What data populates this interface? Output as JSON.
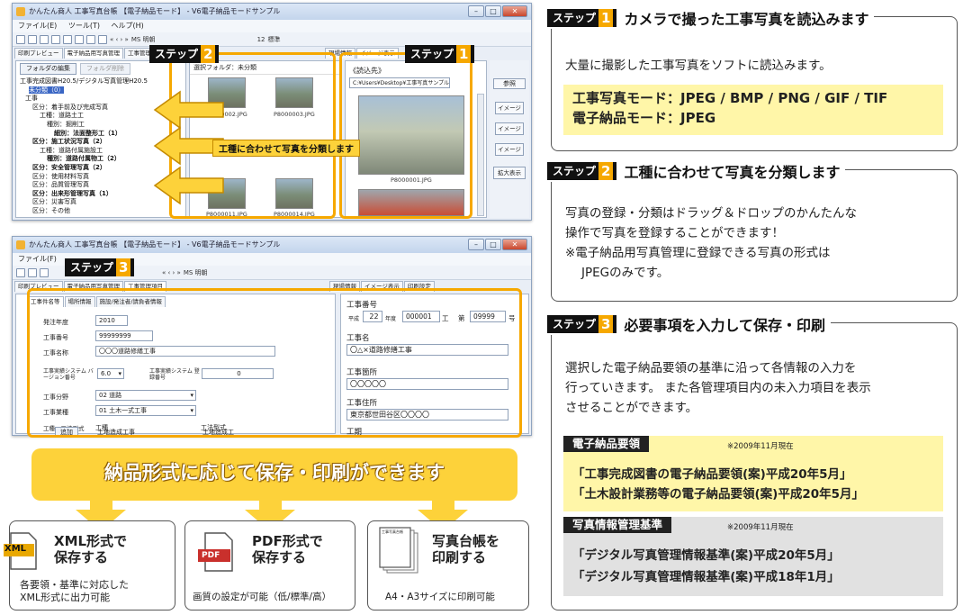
{
  "colors": {
    "accent": "#f6a800",
    "banner": "#fdd23a",
    "badge_bg": "#111111",
    "yellow_box": "#fff6a8",
    "gray_box": "#e1e1e1"
  },
  "window1": {
    "title": "かんたん商人 工事写真台帳 【電子納品モード】 - V6電子納品モードサンプル",
    "menu": [
      "ファイル(E)",
      "ツール(T)",
      "ヘルプ(H)"
    ],
    "tabs": [
      "印刷プレビュー",
      "電子納品用写真管理",
      "工事管理項目"
    ],
    "right_tabs": [
      "現場情報",
      "イメージ表示"
    ],
    "folder_btn": "フォルダの編集",
    "folder_del": "フォルダ削除",
    "current_folder": "選択フォルダ：未分類",
    "tree": [
      "工事完成図書H20.5/デジタル写真管理H20.5",
      "未分類（0）",
      "工事",
      "区分：着手前及び完成写真",
      "工種：道路土工",
      "種別：掘削工",
      "細別：法面整形工（1）",
      "区分：施工状況写真（2）",
      "工種：道路付属施設工",
      "種別：道路付属物工（2）",
      "区分：安全管理写真（2）",
      "区分：使用材料写真",
      "区分：品質管理写真",
      "区分：出来形管理写真（1）",
      "区分：災害写真",
      "区分：その他"
    ],
    "thumbs": [
      "P8000002.JPG",
      "P8000003.JPG",
      "P8000011.JPG",
      "P8000014.JPG"
    ],
    "callout": "工種に合わせて写真を分類します",
    "read_label": "《読込先》",
    "read_path": "C:¥Users¥Desktop¥工事写真サンプル",
    "ref_btn": "参照",
    "img_btns": [
      "イメージ",
      "イメージ",
      "イメージ"
    ],
    "zoom_btn": "拡大表示",
    "preview_caption": "P8000001.JPG",
    "font_name": "MS 明朝",
    "font_size": "12",
    "font_style": "標準"
  },
  "window2": {
    "title": "かんたん商人 工事写真台帳 【電子納品モード】 - V6電子納品モードサンプル",
    "menu": "ファイル(F)",
    "tabs": [
      "印刷プレビュー",
      "電子納品用写真管理",
      "工事管理項目"
    ],
    "subtabs": [
      "工事件名等",
      "場所情報",
      "施設/発注者/請負者情報"
    ],
    "right_tabs": [
      "現場情報",
      "イメージ表示",
      "印刷設定"
    ],
    "fields": {
      "year_label": "発注年度",
      "year": "2010",
      "no_label": "工事番号",
      "no": "99999999",
      "name_label": "工事名称",
      "name": "〇〇〇道路修繕工事",
      "sys_label": "工事実績システム バージョン番号",
      "sys": "6.0",
      "reg_label": "工事実績システム 登録番号",
      "reg": "0",
      "field_label": "工事分野",
      "field": "02 道路",
      "type_label": "工事業種",
      "type": "01 土木一式工事",
      "method_label": "工種・工法型式",
      "add_btn": "追加",
      "col1": "工種",
      "col2": "工法型式",
      "row1a": "土地造成工事",
      "row1b": "土地造成工",
      "row2a": "運搬付帯施設工事",
      "row2b": "運搬付帯施設工"
    },
    "right": {
      "no_label": "工事番号",
      "era": "平成",
      "era_year": "22",
      "nendo": "年度",
      "code": "000001",
      "kou": "工",
      "dai": "第",
      "num": "09999",
      "gou": "号",
      "name_label": "工事名",
      "name": "〇△×道路修繕工事",
      "place_label": "工事箇所",
      "place": "〇〇〇〇〇",
      "addr_label": "工事住所",
      "addr": "東京都世田谷区〇〇〇〇",
      "period_label": "工期"
    }
  },
  "steps": {
    "label": "ステップ",
    "n1": "1",
    "n2": "2",
    "n3": "3"
  },
  "banner": "納品形式に応じて保存・印刷ができます",
  "cards": [
    {
      "icon": "XML",
      "title1": "XML形式で",
      "title2": "保存する",
      "desc1": "各要領・基準に対応した",
      "desc2": "XML形式に出力可能"
    },
    {
      "icon": "PDF",
      "title1": "PDF形式で",
      "title2": "保存する",
      "desc1": "画質の設定が可能（低/標準/高）",
      "desc2": ""
    },
    {
      "icon": "工事写真台帳",
      "title1": "写真台帳を",
      "title2": "印刷する",
      "desc1": "A4・A3サイズに印刷可能",
      "desc2": ""
    }
  ],
  "right1": {
    "heading": "カメラで撮った工事写真を読込みます",
    "text": "大量に撮影した工事写真をソフトに読込みます。",
    "mode1": "工事写真モード：JPEG / BMP / PNG / GIF / TIF",
    "mode2": "電子納品モード：JPEG"
  },
  "right2": {
    "heading": "工種に合わせて写真を分類します",
    "line1": "写真の登録・分類はドラッグ＆ドロップのかんたんな",
    "line2": "操作で写真を登録することができます！",
    "line3": "※電子納品用写真管理に登録できる写真の形式は",
    "line4": "JPEGのみです。"
  },
  "right3": {
    "heading": "必要事項を入力して保存・印刷",
    "line1": "選択した電子納品要領の基準に沿って各情報の入力を",
    "line2": "行っていきます。 また各管理項目内の未入力項目を表示",
    "line3": "させることができます。",
    "std1_label": "電子納品要領",
    "std1_note": "※2009年11月現在",
    "std1_a": "「工事完成図書の電子納品要領(案)平成20年5月」",
    "std1_b": "「土木設計業務等の電子納品要領(案)平成20年5月」",
    "std2_label": "写真情報管理基準",
    "std2_note": "※2009年11月現在",
    "std2_a": "「デジタル写真管理情報基準(案)平成20年5月」",
    "std2_b": "「デジタル写真管理情報基準(案)平成18年1月」"
  }
}
